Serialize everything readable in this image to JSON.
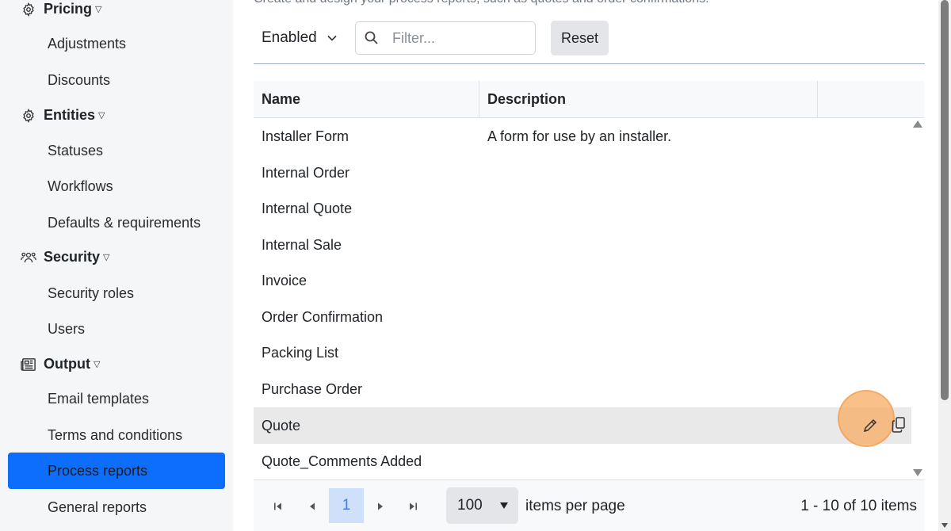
{
  "sidebar": {
    "sections": [
      {
        "label": "Pricing",
        "icon": "gear-icon",
        "items": [
          "Adjustments",
          "Discounts"
        ]
      },
      {
        "label": "Entities",
        "icon": "gear-icon",
        "items": [
          "Statuses",
          "Workflows",
          "Defaults & requirements"
        ]
      },
      {
        "label": "Security",
        "icon": "users-icon",
        "items": [
          "Security roles",
          "Users"
        ]
      },
      {
        "label": "Output",
        "icon": "newspaper-icon",
        "items": [
          "Email templates",
          "Terms and conditions",
          "Process reports",
          "General reports"
        ]
      }
    ],
    "active_item": "Process reports"
  },
  "main": {
    "description_clipped": "Create and design your process reports, such as quotes and order confirmations.",
    "status_filter": "Enabled",
    "search_placeholder": "Filter...",
    "reset_label": "Reset"
  },
  "grid": {
    "columns": [
      "Name",
      "Description"
    ],
    "rows": [
      {
        "name": "Installer Form",
        "description": "A form for use by an installer."
      },
      {
        "name": "Internal Order",
        "description": ""
      },
      {
        "name": "Internal Quote",
        "description": ""
      },
      {
        "name": "Internal Sale",
        "description": ""
      },
      {
        "name": "Invoice",
        "description": ""
      },
      {
        "name": "Order Confirmation",
        "description": ""
      },
      {
        "name": "Packing List",
        "description": ""
      },
      {
        "name": "Purchase Order",
        "description": ""
      },
      {
        "name": "Quote",
        "description": ""
      },
      {
        "name": "Quote_Comments Added",
        "description": ""
      }
    ],
    "selected_row": "Quote",
    "row_actions": [
      "pencil-icon",
      "copy-icon"
    ]
  },
  "pager": {
    "current_page": "1",
    "page_size": "100",
    "items_per_page_label": "items per page",
    "info": "1 - 10 of 10 items"
  },
  "colors": {
    "active_item_bg": "#0d6efd",
    "selected_row_bg": "#e9e9e9",
    "highlight_circle": "#f7ac62",
    "current_page_bg": "#cfe0fb"
  }
}
